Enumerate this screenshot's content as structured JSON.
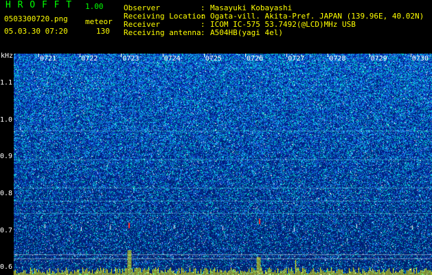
{
  "app": {
    "name": "H R O F F T",
    "version": "1.00"
  },
  "file": {
    "name": "0503300720.png",
    "datetime": "05.03.30 07:20"
  },
  "counter": {
    "label": "meteor",
    "count": "130"
  },
  "info": [
    {
      "key": "Observer",
      "value": "Masayuki Kobayashi"
    },
    {
      "key": "Receiving Location",
      "value": "Ogata-vill. Akita-Pref. JAPAN (139.96E, 40.02N)"
    },
    {
      "key": "Receiver",
      "value": "ICOM IC-575 53.7492(@LCD)MHz USB"
    },
    {
      "key": "Receiving antenna",
      "value": "A504HB(yagi 4el)"
    }
  ],
  "axis": {
    "unit": "kHz",
    "freq_ticks": [
      "1.1",
      "1.0",
      "0.9",
      "0.8",
      "0.7",
      "0.6"
    ],
    "freq_values": [
      1.1,
      1.0,
      0.9,
      0.8,
      0.7,
      0.6
    ],
    "freq_range": [
      0.58,
      1.18
    ],
    "time_ticks": [
      "0721",
      "0722",
      "0723",
      "0724",
      "0725",
      "0726",
      "0727",
      "0728",
      "0729",
      "0730"
    ]
  },
  "colors": {
    "title": "#00ff00",
    "header_text": "#ffff00",
    "axis_text": "#ffffff",
    "background": "#000000",
    "noise_low": "#001a8c",
    "noise_mid": "#1a78ff",
    "noise_high": "#00ffc0",
    "amplitude_bar": "#ffff00"
  }
}
